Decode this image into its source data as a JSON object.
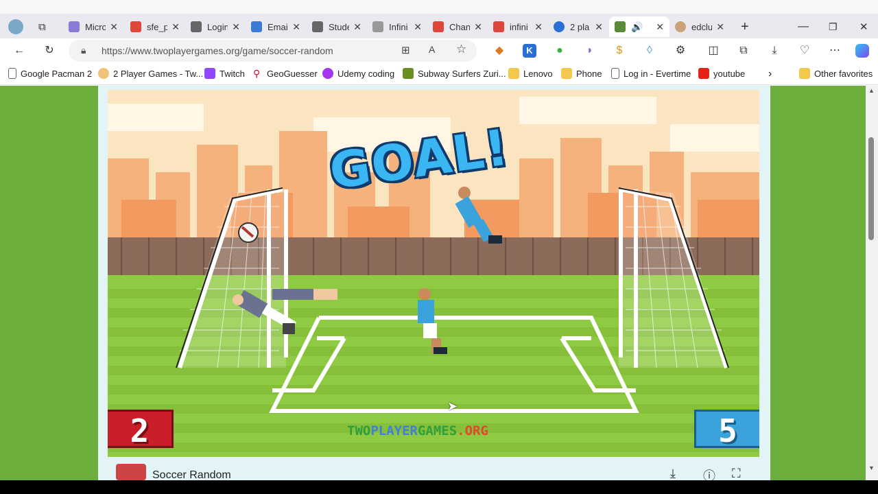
{
  "tabs": [
    {
      "title": "Micro",
      "color": "#8a7bd6"
    },
    {
      "title": "sfe_p",
      "color": "#e0473c"
    },
    {
      "title": "Login",
      "color": "#666666"
    },
    {
      "title": "Email",
      "color": "#3a7bd5"
    },
    {
      "title": "Stude",
      "color": "#666666"
    },
    {
      "title": "Infini",
      "color": "#999999"
    },
    {
      "title": "Chan",
      "color": "#e0473c"
    },
    {
      "title": "infini",
      "color": "#e0473c"
    },
    {
      "title": "2 pla",
      "color": "#2a6fd6"
    },
    {
      "title": "",
      "color": "#5a8a3a"
    },
    {
      "title": "edclu",
      "color": "#c9a27a"
    }
  ],
  "address": {
    "url": "https://www.twoplayergames.org/game/soccer-random"
  },
  "favorites": [
    {
      "label": "Google Pacman 2",
      "icon": "page-icon"
    },
    {
      "label": "2 Player Games - Tw...",
      "icon": "site-icon"
    },
    {
      "label": "Twitch",
      "icon": "twitch-icon"
    },
    {
      "label": "GeoGuesser",
      "icon": "pin-icon"
    },
    {
      "label": "Udemy coding",
      "icon": "udemy-icon"
    },
    {
      "label": "Subway Surfers Zuri...",
      "icon": "site-icon"
    },
    {
      "label": "Lenovo",
      "icon": "folder-icon"
    },
    {
      "label": "Phone",
      "icon": "folder-icon"
    },
    {
      "label": "Log in - Evertime",
      "icon": "page-icon"
    },
    {
      "label": "youtube",
      "icon": "youtube-icon"
    },
    {
      "label": "Other favorites",
      "icon": "folder-icon"
    }
  ],
  "game": {
    "banner": "GOAL!",
    "score_left": "2",
    "score_right": "5",
    "watermark_a": "TWO",
    "watermark_b": "PLAYER",
    "watermark_c": "GAMES",
    "watermark_d": ".ORG",
    "title": "Soccer Random",
    "colors": {
      "sky": "#fbe5c0",
      "city": "#f2a36a",
      "fence": "#8d6b5a",
      "grass": "#8fcb42",
      "red_team": "#c81f2a",
      "blue_team": "#3aa3db"
    }
  }
}
